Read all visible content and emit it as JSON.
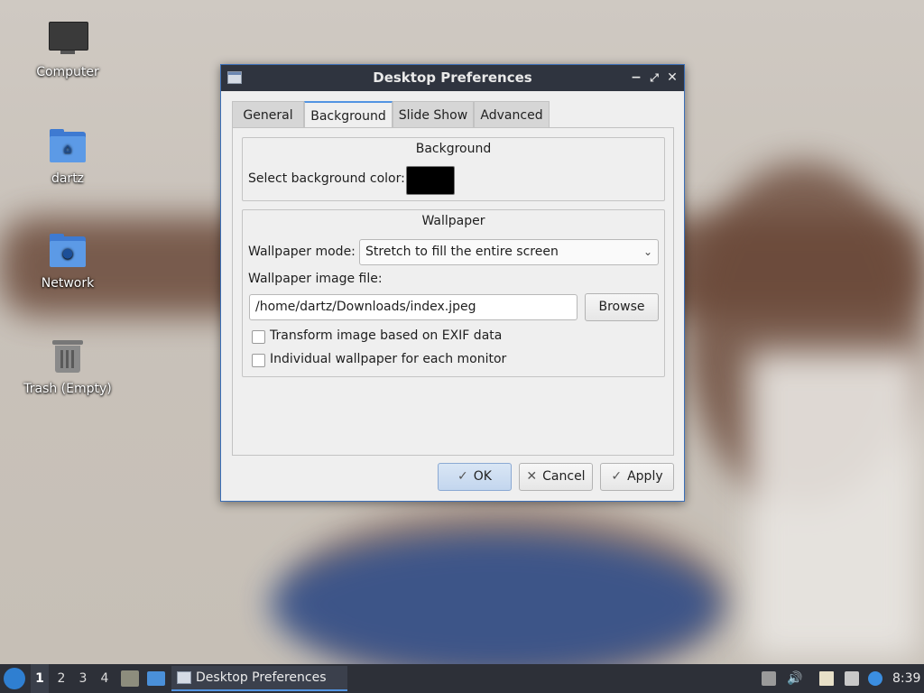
{
  "desktop": {
    "icons": [
      {
        "label": "Computer"
      },
      {
        "label": "dartz"
      },
      {
        "label": "Network"
      },
      {
        "label": "Trash (Empty)"
      }
    ]
  },
  "dialog": {
    "title": "Desktop Preferences",
    "controls": {
      "minimize": "−",
      "maximize": "⤢",
      "close": "✕"
    },
    "tabs": [
      {
        "label": "General",
        "active": false
      },
      {
        "label": "Background",
        "active": true
      },
      {
        "label": "Slide Show",
        "active": false
      },
      {
        "label": "Advanced",
        "active": false
      }
    ],
    "background_frame": {
      "title": "Background",
      "color_label": "Select background color:",
      "color_value": "#000000"
    },
    "wallpaper_frame": {
      "title": "Wallpaper",
      "mode_label": "Wallpaper mode:",
      "mode_value": "Stretch to fill the entire screen",
      "file_label": "Wallpaper image file:",
      "file_value": "/home/dartz/Downloads/index.jpeg",
      "browse_label": "Browse",
      "exif_label": "Transform image based on EXIF data",
      "exif_checked": false,
      "monitor_label": "Individual wallpaper for each monitor",
      "monitor_checked": false
    },
    "buttons": {
      "ok": "OK",
      "cancel": "Cancel",
      "apply": "Apply"
    }
  },
  "taskbar": {
    "workspaces": [
      "1",
      "2",
      "3",
      "4"
    ],
    "active_workspace": "1",
    "task_title": "Desktop Preferences",
    "clock": "8:39"
  },
  "colors": {
    "accent": "#5294e2",
    "titlebar": "#2f343f",
    "taskbar": "#2d3038"
  }
}
